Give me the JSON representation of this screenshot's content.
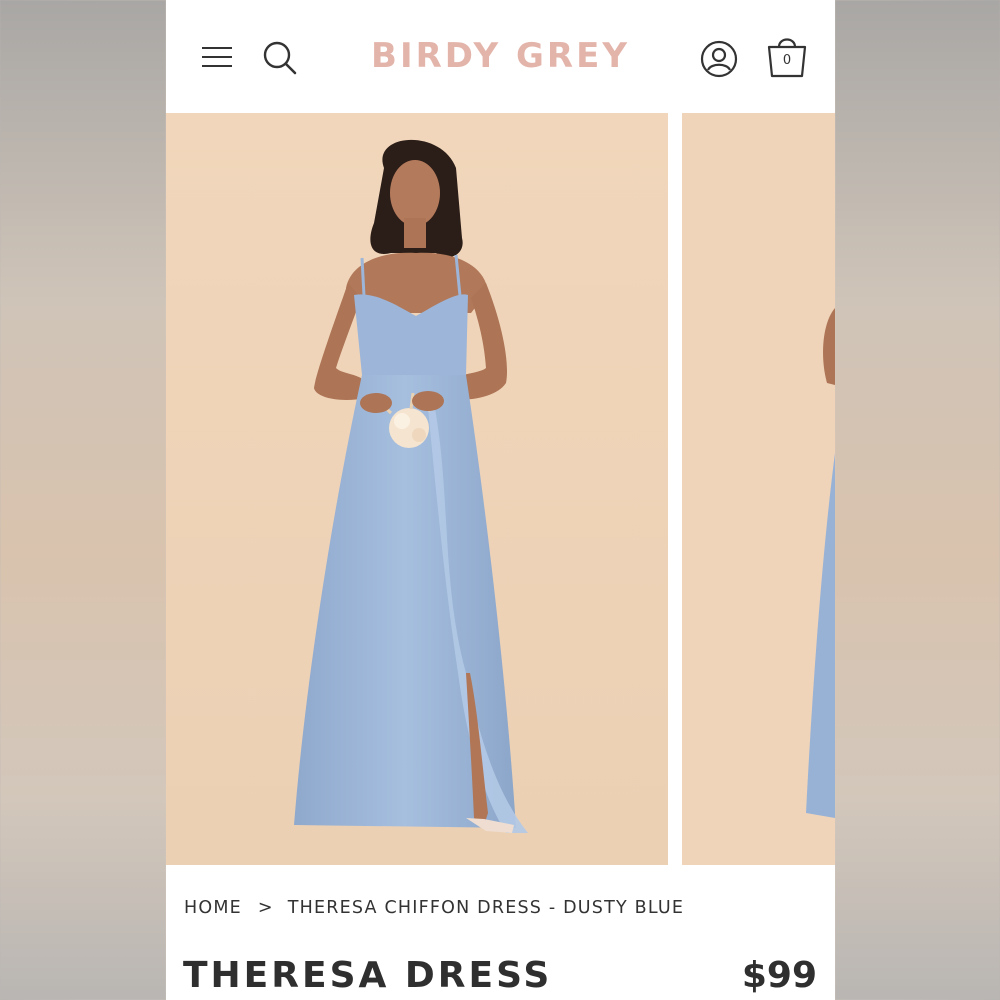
{
  "header": {
    "logo": "BIRDY GREY",
    "bag_count": "0"
  },
  "icons": [
    "menu-icon",
    "search-icon",
    "account-icon",
    "shopping-bag-icon"
  ],
  "colors": {
    "logo": "#e3b4aa",
    "photo_background": "#f0d5ba",
    "dress": "#9db7d9"
  },
  "breadcrumb": {
    "home": "HOME",
    "separator": ">",
    "current": "THERESA CHIFFON DRESS - DUSTY BLUE"
  },
  "product": {
    "title": "THERESA DRESS",
    "price": "$99"
  }
}
